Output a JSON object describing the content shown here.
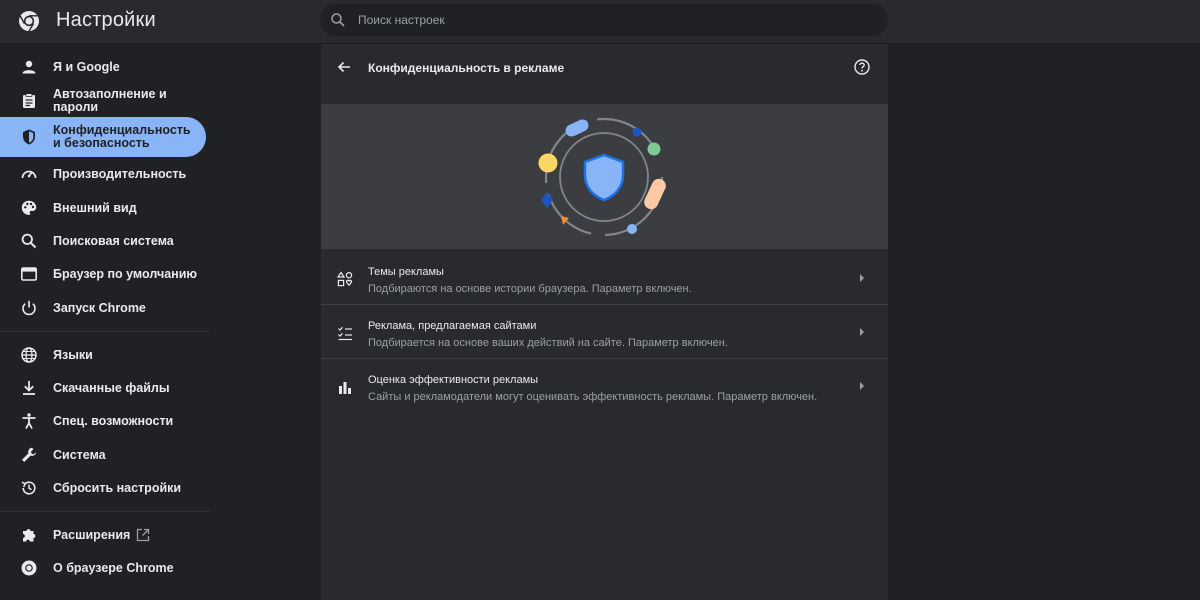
{
  "app": {
    "title": "Настройки",
    "logo_icon": "chrome-logo-icon"
  },
  "search": {
    "placeholder": "Поиск настроек",
    "icon": "search-icon"
  },
  "sidebar": {
    "items": [
      {
        "label": "Я и Google",
        "icon": "person-icon"
      },
      {
        "label": "Автозаполнение и пароли",
        "icon": "clipboard-icon"
      },
      {
        "label": "Конфиденциальность и безопасность",
        "icon": "shield-icon",
        "active": true
      },
      {
        "label": "Производительность",
        "icon": "speedometer-icon"
      },
      {
        "label": "Внешний вид",
        "icon": "palette-icon"
      },
      {
        "label": "Поисковая система",
        "icon": "search-icon"
      },
      {
        "label": "Браузер по умолчанию",
        "icon": "browser-icon"
      },
      {
        "label": "Запуск Chrome",
        "icon": "power-icon"
      },
      {
        "label": "Языки",
        "icon": "globe-icon"
      },
      {
        "label": "Скачанные файлы",
        "icon": "download-icon"
      },
      {
        "label": "Спец. возможности",
        "icon": "accessibility-icon"
      },
      {
        "label": "Система",
        "icon": "wrench-icon"
      },
      {
        "label": "Сбросить настройки",
        "icon": "reset-icon"
      },
      {
        "label": "Расширения",
        "icon": "puzzle-icon"
      },
      {
        "label": "О браузере Chrome",
        "icon": "chrome-logo-icon"
      }
    ]
  },
  "page": {
    "title": "Конфиденциальность в рекламе"
  },
  "rows": [
    {
      "title": "Темы рекламы",
      "subtitle": "Подбираются на основе истории браузера. Параметр включен.",
      "icon": "topics-icon"
    },
    {
      "title": "Реклама, предлагаемая сайтами",
      "subtitle": "Подбирается на основе ваших действий на сайте. Параметр включен.",
      "icon": "checklist-icon"
    },
    {
      "title": "Оценка эффективности рекламы",
      "subtitle": "Сайты и рекламодатели могут оценивать эффективность рекламы. Параметр включен.",
      "icon": "bar-chart-icon"
    }
  ],
  "colors": {
    "accent": "#8ab4f8",
    "background": "#202124",
    "surface": "#292a2d",
    "hero": "#3c3d40",
    "text": "#e8eaed",
    "secondary_text": "#9aa0a6"
  }
}
